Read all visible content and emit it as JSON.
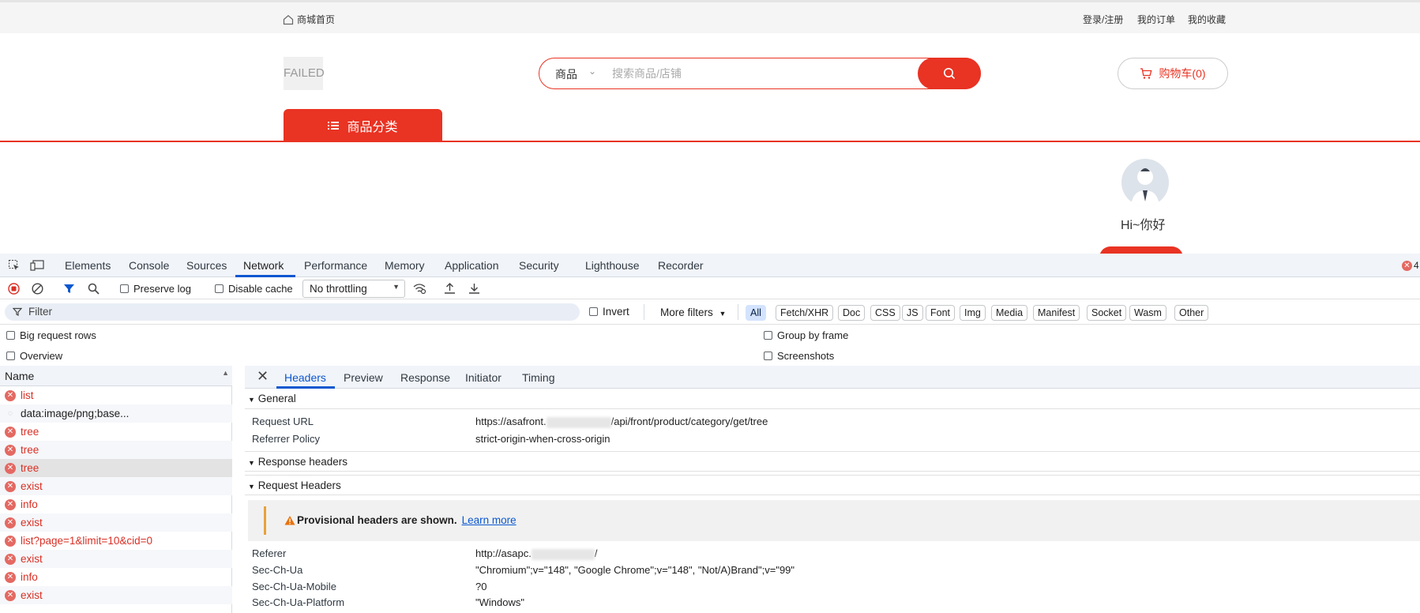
{
  "topbar": {
    "home_label": "商城首页",
    "links": [
      "登录/注册",
      "我的订单",
      "我的收藏"
    ]
  },
  "header": {
    "logo_text": "FAILED",
    "search_select": "商品",
    "search_placeholder": "搜索商品/店铺",
    "cart_label": "购物车(0)",
    "category_button": "商品分类",
    "greeting": "Hi~你好"
  },
  "devtools": {
    "tabs": [
      "Elements",
      "Console",
      "Sources",
      "Network",
      "Performance",
      "Memory",
      "Application",
      "Security",
      "Lighthouse",
      "Recorder"
    ],
    "active_tab": "Network",
    "error_count": "4",
    "toolbar": {
      "preserve_log": "Preserve log",
      "disable_cache": "Disable cache",
      "throttling": "No throttling"
    },
    "filter": {
      "placeholder": "Filter",
      "invert": "Invert",
      "more_filters": "More filters",
      "types": [
        "All",
        "Fetch/XHR",
        "Doc",
        "CSS",
        "JS",
        "Font",
        "Img",
        "Media",
        "Manifest",
        "Socket",
        "Wasm",
        "Other"
      ],
      "active_type": "All"
    },
    "options": {
      "big_request_rows": "Big request rows",
      "group_by_frame": "Group by frame",
      "overview": "Overview",
      "screenshots": "Screenshots"
    },
    "name_header": "Name",
    "requests": [
      {
        "name": "list",
        "status": "error"
      },
      {
        "name": "data:image/png;base...",
        "status": "pending"
      },
      {
        "name": "tree",
        "status": "error"
      },
      {
        "name": "tree",
        "status": "error"
      },
      {
        "name": "tree",
        "status": "error",
        "selected": true
      },
      {
        "name": "exist",
        "status": "error"
      },
      {
        "name": "info",
        "status": "error"
      },
      {
        "name": "exist",
        "status": "error"
      },
      {
        "name": "list?page=1&limit=10&cid=0",
        "status": "error"
      },
      {
        "name": "exist",
        "status": "error"
      },
      {
        "name": "info",
        "status": "error"
      },
      {
        "name": "exist",
        "status": "error"
      }
    ],
    "detail_tabs": [
      "Headers",
      "Preview",
      "Response",
      "Initiator",
      "Timing"
    ],
    "detail_active": "Headers",
    "general": {
      "title": "General",
      "request_url_key": "Request URL",
      "request_url_prefix": "https://asafront.",
      "request_url_suffix": "/api/front/product/category/get/tree",
      "referrer_policy_key": "Referrer Policy",
      "referrer_policy": "strict-origin-when-cross-origin"
    },
    "response_headers_title": "Response headers",
    "request_headers": {
      "title": "Request Headers",
      "provisional_text": "Provisional headers are shown.",
      "learn_more": "Learn more",
      "referer_key": "Referer",
      "referer_prefix": "http://asapc.",
      "referer_suffix": "/",
      "sec_ch_ua_key": "Sec-Ch-Ua",
      "sec_ch_ua": "\"Chromium\";v=\"148\", \"Google Chrome\";v=\"148\", \"Not/A)Brand\";v=\"99\"",
      "sec_ch_ua_mobile_key": "Sec-Ch-Ua-Mobile",
      "sec_ch_ua_mobile": "?0",
      "sec_ch_ua_platform_key": "Sec-Ch-Ua-Platform",
      "sec_ch_ua_platform": "\"Windows\""
    }
  },
  "colors": {
    "brand_red": "#e93323",
    "devtools_blue": "#0b57d0",
    "error_red": "#d93025"
  }
}
